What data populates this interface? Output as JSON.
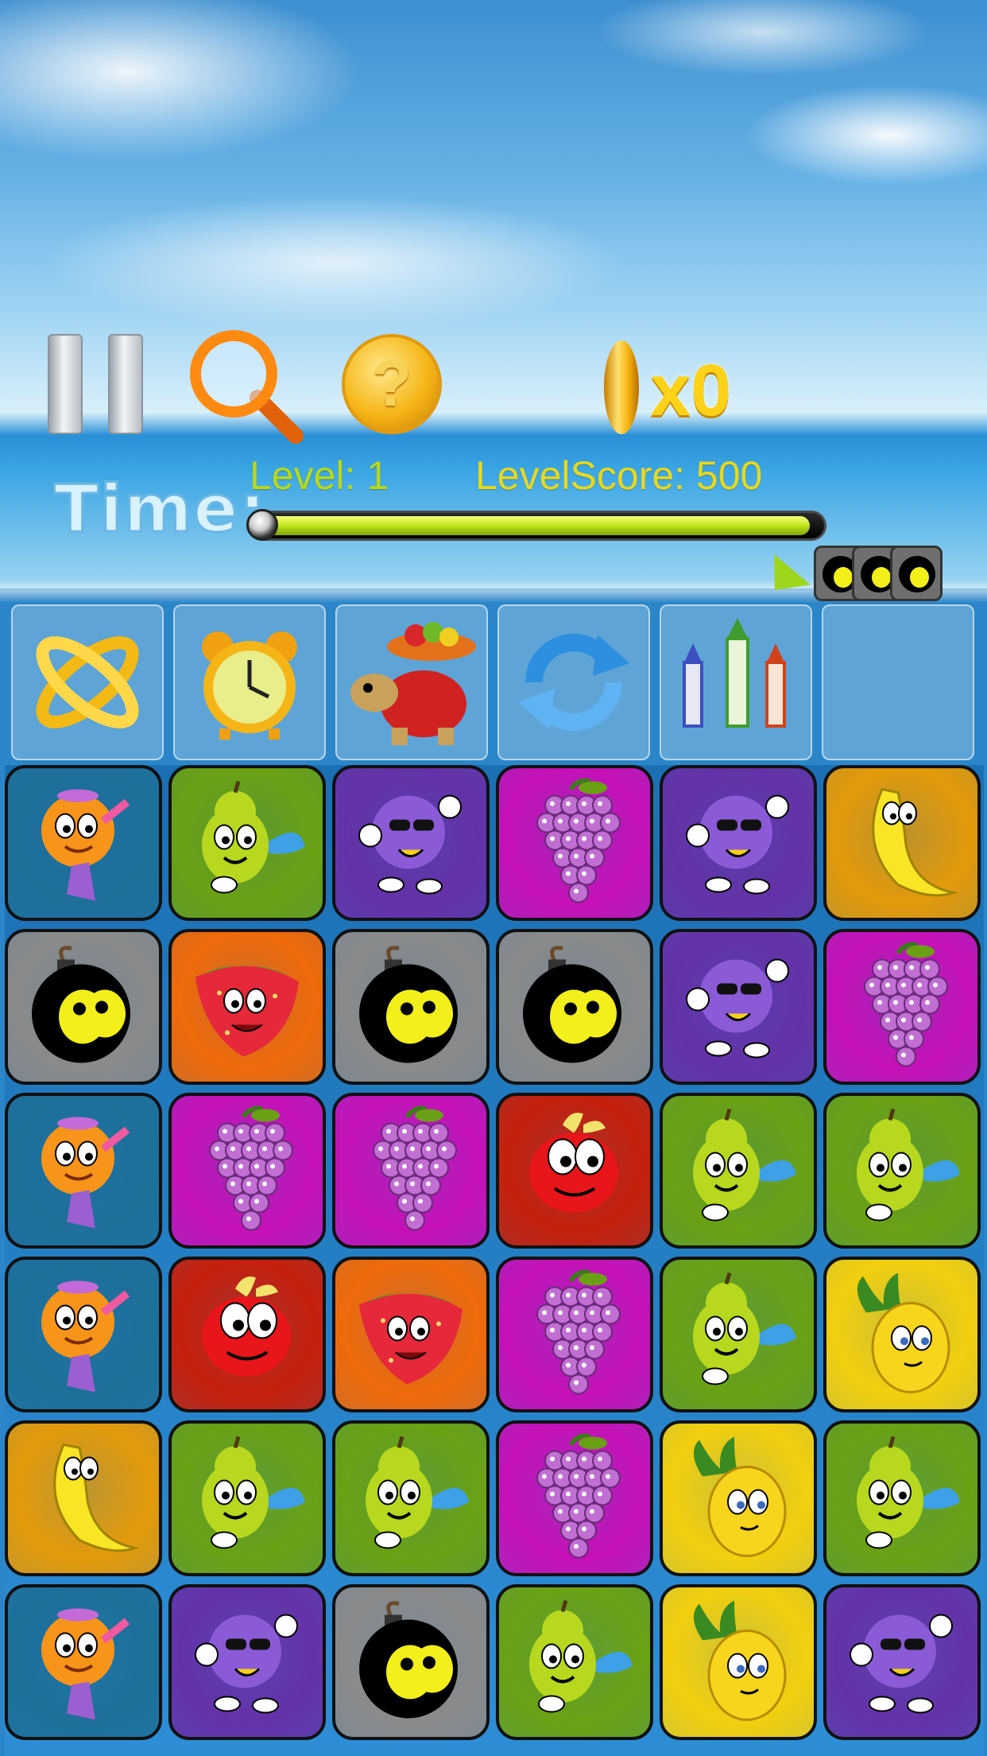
{
  "hud": {
    "coin_count": "x0",
    "level_text": "Level:  1",
    "level_score_text": "LevelScore: 500",
    "time_label": "Time:",
    "hint_symbol": "?",
    "timer_fraction": 0.98
  },
  "bomb_stack_count": 3,
  "powerups": [
    {
      "name": "coin-ring-powerup",
      "icon": "gold-coin-ring"
    },
    {
      "name": "alarm-clock-powerup",
      "icon": "alarm-clock"
    },
    {
      "name": "turtle-fruit-bowl-powerup",
      "icon": "turtle-with-fruit-bowl"
    },
    {
      "name": "shuffle-powerup",
      "icon": "refresh-arrows"
    },
    {
      "name": "fireworks-powerup",
      "icon": "rockets"
    },
    {
      "name": "empty-powerup-slot",
      "icon": ""
    }
  ],
  "colors": {
    "orange": "#1e6f9a",
    "pear": "#6aa114",
    "plum": "#6432a8",
    "grape": "#c511b7",
    "banana": "#e29a0b",
    "bomb": "#8a8a8a",
    "strawberry": "#ef6a0a",
    "apple": "#c5200c",
    "pineapple": "#f2cf0f"
  },
  "board": [
    [
      "orange",
      "pear",
      "plum",
      "grape",
      "plum",
      "banana"
    ],
    [
      "bomb",
      "strawberry",
      "bomb",
      "bomb",
      "plum",
      "grape"
    ],
    [
      "orange",
      "grape",
      "grape",
      "apple",
      "pear",
      "pear"
    ],
    [
      "orange",
      "apple",
      "strawberry",
      "grape",
      "pear",
      "pineapple"
    ],
    [
      "banana",
      "pear",
      "pear",
      "grape",
      "pineapple",
      "pear"
    ],
    [
      "orange",
      "plum",
      "bomb",
      "pear",
      "pineapple",
      "plum"
    ]
  ]
}
